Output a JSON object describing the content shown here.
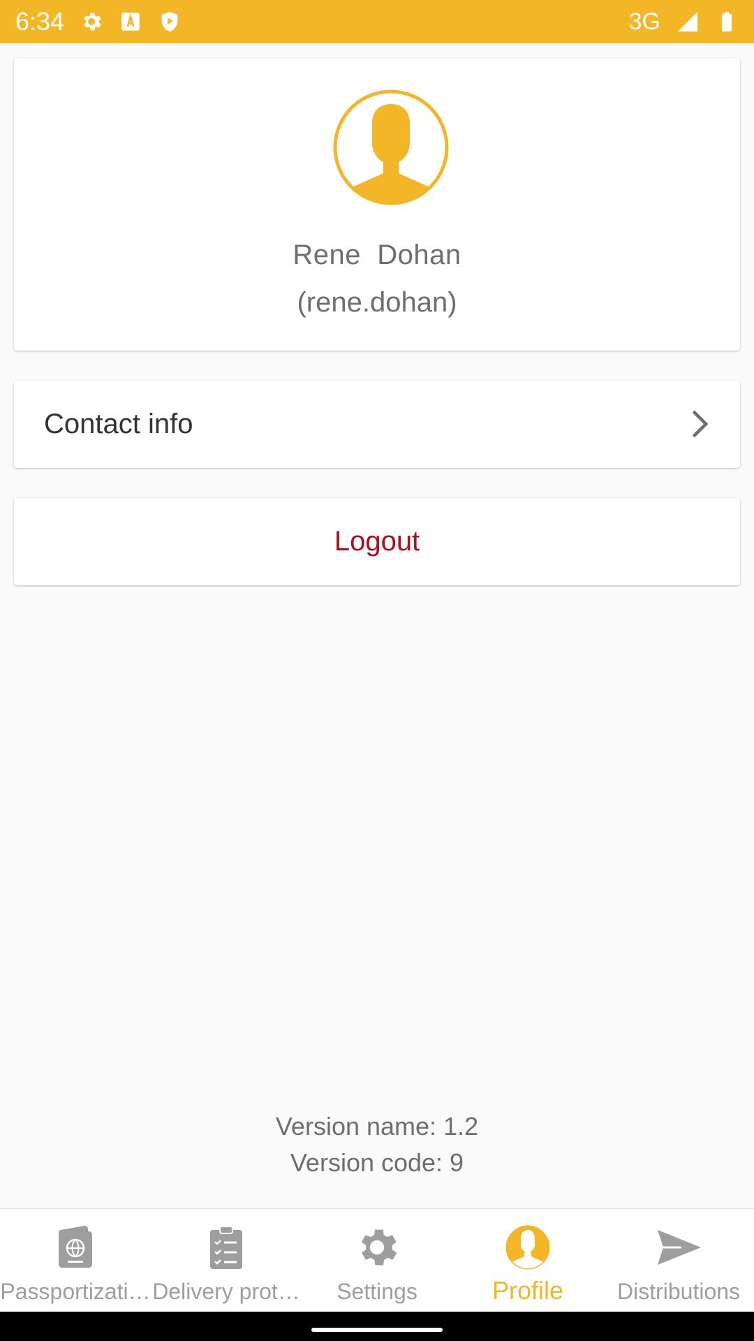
{
  "status_bar": {
    "time": "6:34",
    "network": "3G",
    "icons": [
      "settings-icon",
      "text-a-icon",
      "shield-play-icon",
      "signal-icon",
      "battery-icon"
    ]
  },
  "profile": {
    "full_name": "Rene  Dohan",
    "username": "(rene.dohan)"
  },
  "contact_info": {
    "label": "Contact info"
  },
  "logout": {
    "label": "Logout"
  },
  "version": {
    "name": "Version name: 1.2",
    "code": "Version code: 9"
  },
  "bottom_nav": {
    "items": [
      {
        "label": "Passportizati…",
        "icon": "passport-icon",
        "active": false
      },
      {
        "label": "Delivery prot…",
        "icon": "clipboard-checklist-icon",
        "active": false
      },
      {
        "label": "Settings",
        "icon": "gear-icon",
        "active": false
      },
      {
        "label": "Profile",
        "icon": "person-icon",
        "active": true
      },
      {
        "label": "Distributions",
        "icon": "send-icon",
        "active": false
      }
    ]
  },
  "colors": {
    "accent": "#f2b627",
    "logout": "#b00b1e",
    "inactive": "#9e9e9e",
    "text": "#6e6e6e"
  }
}
